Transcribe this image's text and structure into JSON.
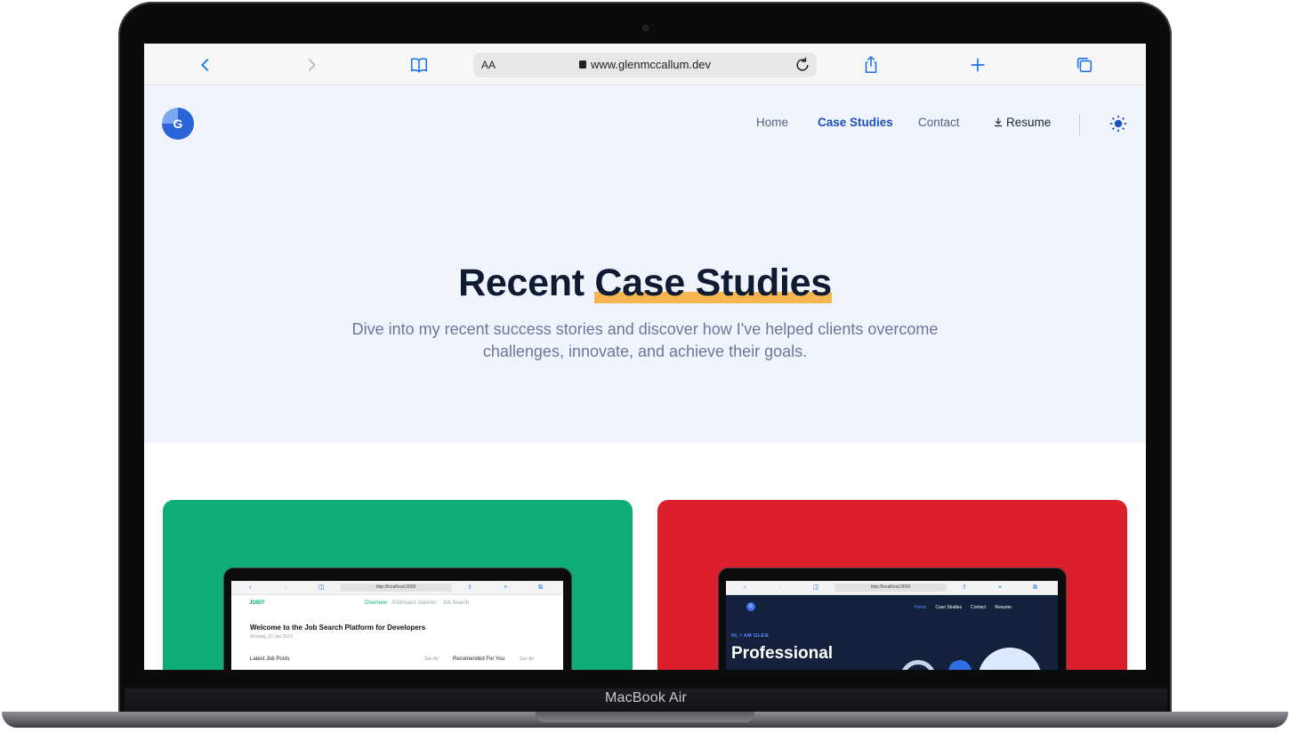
{
  "device": {
    "label": "MacBook Air"
  },
  "browser": {
    "text_size_label": "AA",
    "url": "www.glenmccallum.dev",
    "icons": [
      "back-icon",
      "forward-icon",
      "bookmarks-icon",
      "lock-icon",
      "reload-icon",
      "share-icon",
      "new-tab-icon",
      "tabs-icon"
    ],
    "accent_color": "#1a73e8"
  },
  "site": {
    "logo_letter": "G",
    "nav": {
      "home": "Home",
      "case_studies": "Case Studies",
      "contact": "Contact",
      "resume": "Resume"
    },
    "theme_icon": "sun-icon",
    "hero": {
      "title_plain": "Recent ",
      "title_highlight": "Case Studies",
      "subtitle": "Dive into my recent success stories and discover how I've helped clients overcome challenges, innovate, and achieve their goals."
    },
    "colors": {
      "hero_bg": "#f0f5fd",
      "highlight": "#f7b54f",
      "card_green": "#0ead7a",
      "card_red": "#dc1f2c",
      "active_nav": "#1f4fbf"
    },
    "cards": [
      {
        "preview": {
          "url": "http://localhost:3000",
          "app_name": "JOBIT",
          "tabs": [
            "Overview",
            "Estimated Salaries",
            "Job Search"
          ],
          "heading": "Welcome to the Job Search Platform for Developers",
          "date": "Monday, 13 Jan 2023",
          "section_left": "Latest Job Posts",
          "section_right": "Recomended For You",
          "see_all": "See All"
        }
      },
      {
        "preview": {
          "url": "http://localhost:3000",
          "nav": [
            "Home",
            "Case Studies",
            "Contact",
            "Resume"
          ],
          "greeting": "HI, I AM GLEN",
          "headline": "Professional"
        }
      }
    ]
  }
}
